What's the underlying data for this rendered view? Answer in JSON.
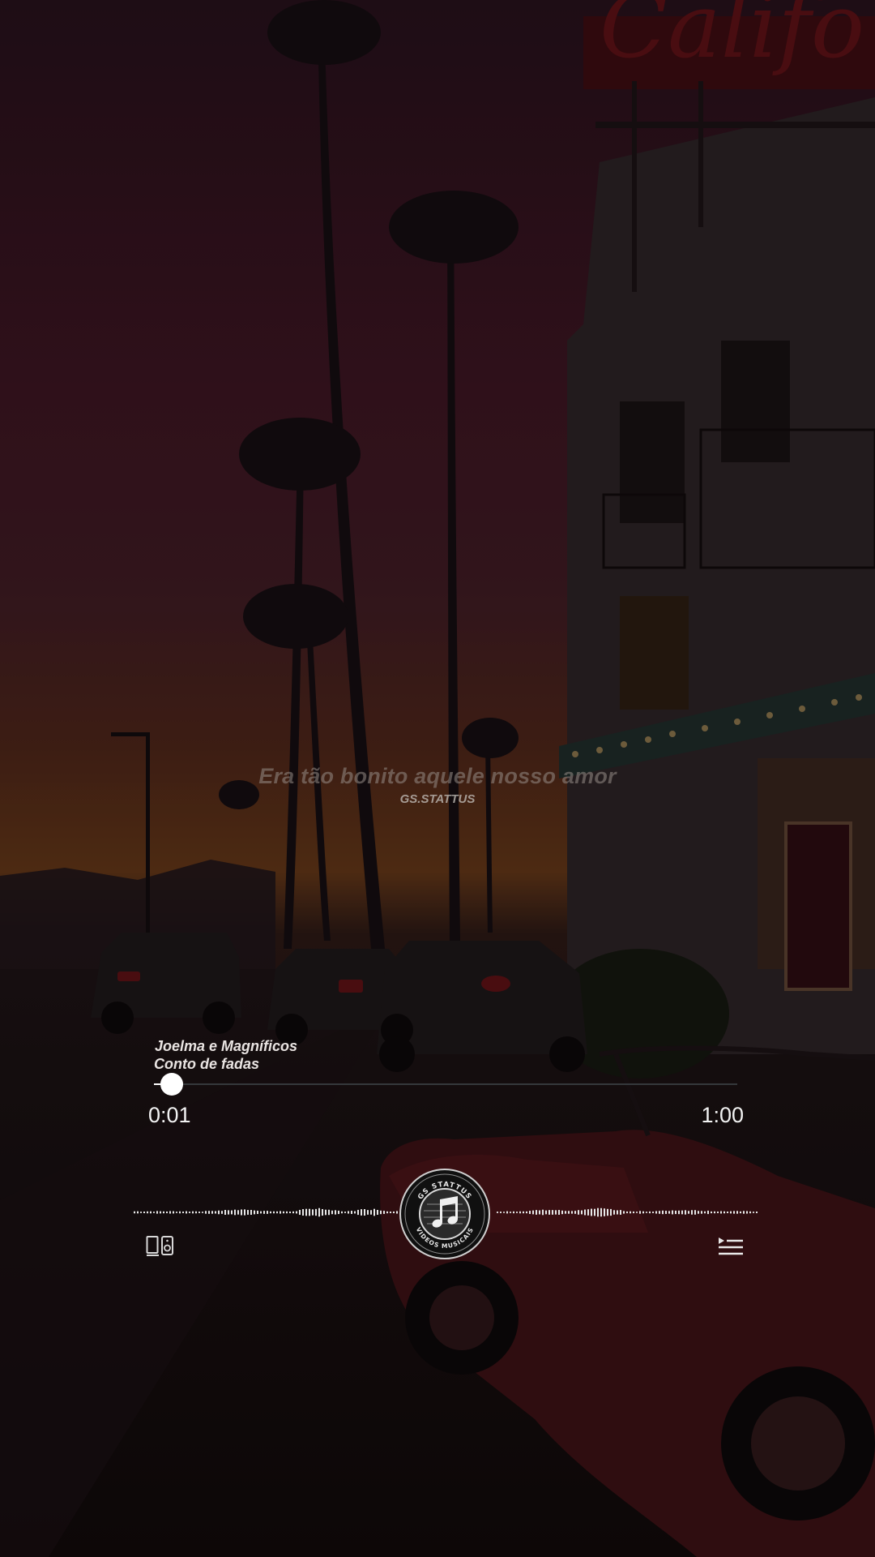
{
  "lyrics": {
    "current_line": "Era tão bonito aquele nosso amor",
    "watermark": "GS.STATTUS"
  },
  "track": {
    "artist": "Joelma e  Magníficos",
    "title": "Conto de fadas"
  },
  "playback": {
    "current_time": "0:01",
    "duration": "1:00",
    "progress": 0.03
  },
  "logo": {
    "top_text": "GS STATTUS",
    "bottom_text": "VIDEOS MUSICAIS"
  },
  "icons": {
    "cast": "cast-to-speaker-icon",
    "playlist": "playlist-icon"
  },
  "colors": {
    "accent": "#ffffff",
    "sky_top": "#3a1420",
    "sky_horizon": "#6a3515",
    "track_bg": "#46505a"
  }
}
